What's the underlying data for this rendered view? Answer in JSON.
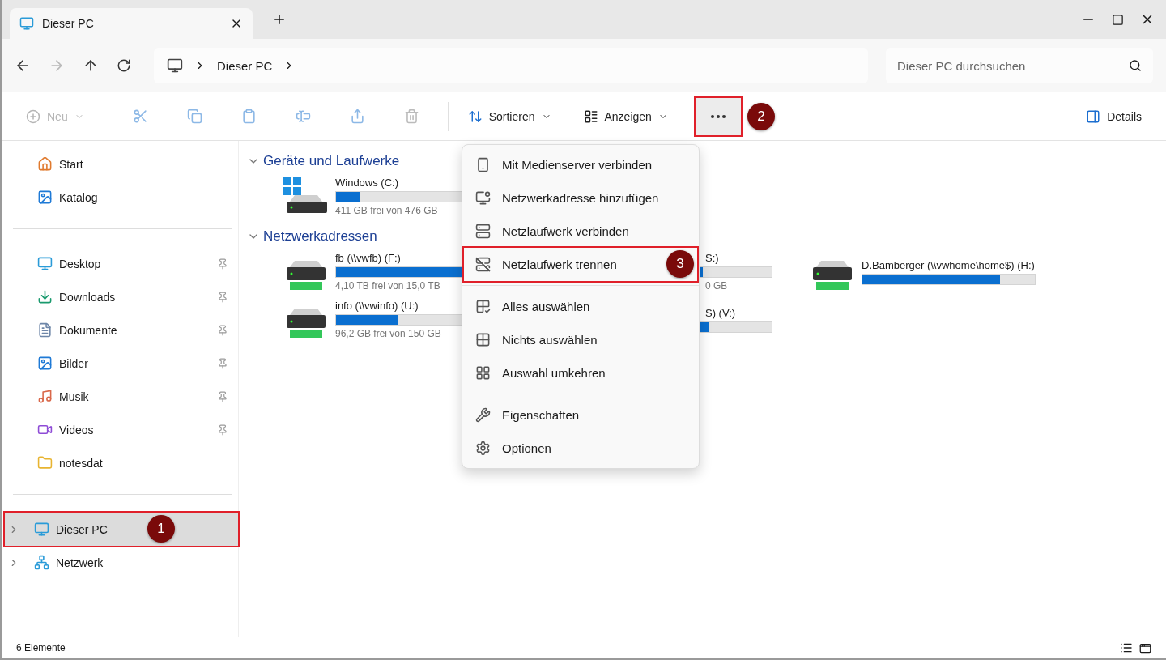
{
  "tab": {
    "title": "Dieser PC"
  },
  "address": {
    "segments": [
      "Dieser PC"
    ]
  },
  "search": {
    "placeholder": "Dieser PC durchsuchen"
  },
  "toolbar": {
    "new": {
      "label": "Neu",
      "disabled": true
    },
    "sort": {
      "label": "Sortieren"
    },
    "view": {
      "label": "Anzeigen"
    },
    "more": {
      "callout": "2"
    },
    "details": {
      "label": "Details"
    }
  },
  "sidebar": {
    "groups": [
      [
        {
          "label": "Start",
          "pinned": false,
          "selected": false
        },
        {
          "label": "Katalog",
          "pinned": false,
          "selected": false
        }
      ],
      [
        {
          "label": "Desktop",
          "pinned": true,
          "selected": false
        },
        {
          "label": "Downloads",
          "pinned": true,
          "selected": false
        },
        {
          "label": "Dokumente",
          "pinned": true,
          "selected": false
        },
        {
          "label": "Bilder",
          "pinned": true,
          "selected": false
        },
        {
          "label": "Musik",
          "pinned": true,
          "selected": false
        },
        {
          "label": "Videos",
          "pinned": true,
          "selected": false
        },
        {
          "label": "notesdat",
          "pinned": false,
          "selected": false
        }
      ],
      [
        {
          "label": "Dieser PC",
          "pinned": false,
          "selected": true,
          "expanded": false,
          "callout": "1"
        },
        {
          "label": "Netzwerk",
          "pinned": false,
          "selected": false,
          "expanded": false
        }
      ]
    ]
  },
  "sections": [
    {
      "title": "Geräte und Laufwerke",
      "expanded": true,
      "drives": [
        {
          "kind": "local",
          "name": "Windows (C:)",
          "level": 0.14,
          "detail": "411 GB frei von 476 GB"
        }
      ]
    },
    {
      "title": "Netzwerkadressen",
      "expanded": true,
      "drives": [
        {
          "kind": "network",
          "name": "fb (\\\\vwfb) (F:)",
          "level": 0.75,
          "detail": "4,10 TB frei von 15,0 TB"
        },
        {
          "kind": "covered",
          "name": "S:)",
          "level": 0.6,
          "detail": "0 GB"
        },
        {
          "kind": "network",
          "name": "D.Bamberger (\\\\vwhome\\home$) (H:)",
          "level": 0.8
        },
        {
          "kind": "network",
          "name": "info (\\\\vwinfo) (U:)",
          "level": 0.36,
          "detail": "96,2 GB frei von 150 GB"
        },
        {
          "kind": "covered",
          "name": "S) (V:)",
          "level": 0.64
        }
      ]
    }
  ],
  "menu": {
    "groups": [
      [
        {
          "label": "Mit Medienserver verbinden"
        },
        {
          "label": "Netzwerkadresse hinzufügen"
        },
        {
          "label": "Netzlaufwerk verbinden"
        },
        {
          "label": "Netzlaufwerk trennen",
          "callout": "3"
        }
      ],
      [
        {
          "label": "Alles auswählen"
        },
        {
          "label": "Nichts auswählen"
        },
        {
          "label": "Auswahl umkehren"
        }
      ],
      [
        {
          "label": "Eigenschaften"
        },
        {
          "label": "Optionen"
        }
      ]
    ]
  },
  "status_bar": {
    "count": "6 Elemente"
  }
}
